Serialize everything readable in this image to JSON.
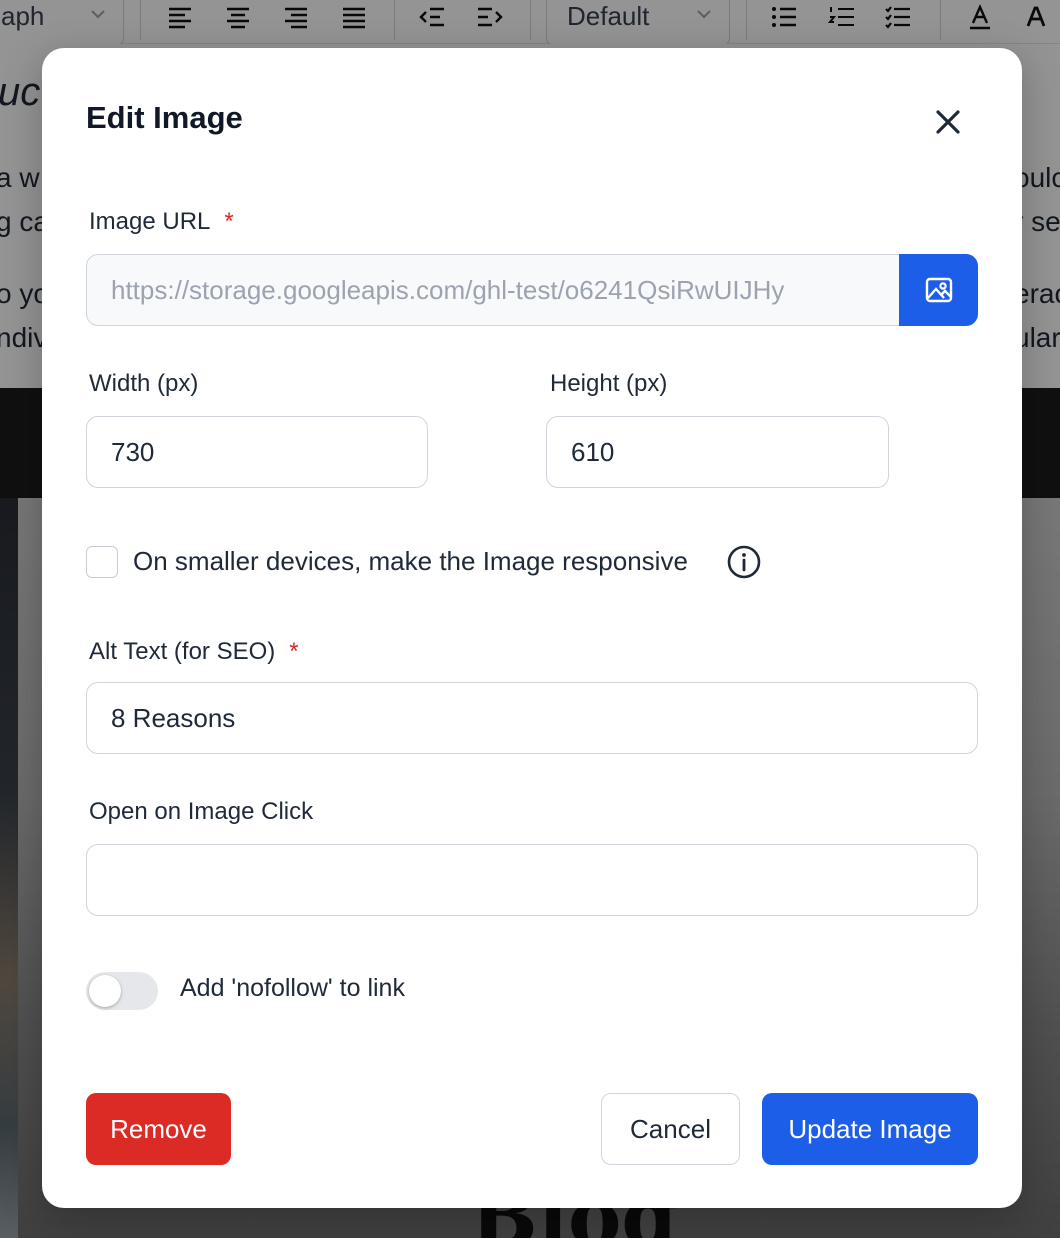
{
  "background": {
    "toolbar": {
      "block_style_fragment": "aph",
      "font_size_select": "Default"
    },
    "document": {
      "title_fragment": "ucti",
      "left_fragments": [
        "a w",
        "g ca",
        "o yo",
        "ndiv"
      ],
      "right_fragments": [
        "oulc",
        "r se",
        "erac",
        "ular"
      ],
      "image_caption_fragment": "Blog"
    }
  },
  "modal": {
    "title": "Edit Image",
    "image_url": {
      "label": "Image URL",
      "required_mark": "*",
      "value": "https://storage.googleapis.com/ghl-test/o6241QsiRwUIJHy"
    },
    "width": {
      "label": "Width (px)",
      "value": "730"
    },
    "height": {
      "label": "Height (px)",
      "value": "610"
    },
    "responsive_checkbox": {
      "label": "On smaller devices, make the Image responsive",
      "checked": false
    },
    "alt_text": {
      "label": "Alt Text (for SEO)",
      "required_mark": "*",
      "value": "8 Reasons"
    },
    "open_on_click": {
      "label": "Open on Image Click",
      "value": ""
    },
    "nofollow_toggle": {
      "label": "Add 'nofollow' to link",
      "enabled": false
    },
    "buttons": {
      "remove": "Remove",
      "cancel": "Cancel",
      "update": "Update Image"
    }
  },
  "colors": {
    "primary": "#1d5ee8",
    "danger": "#dc2a25",
    "required": "#dc2626"
  }
}
